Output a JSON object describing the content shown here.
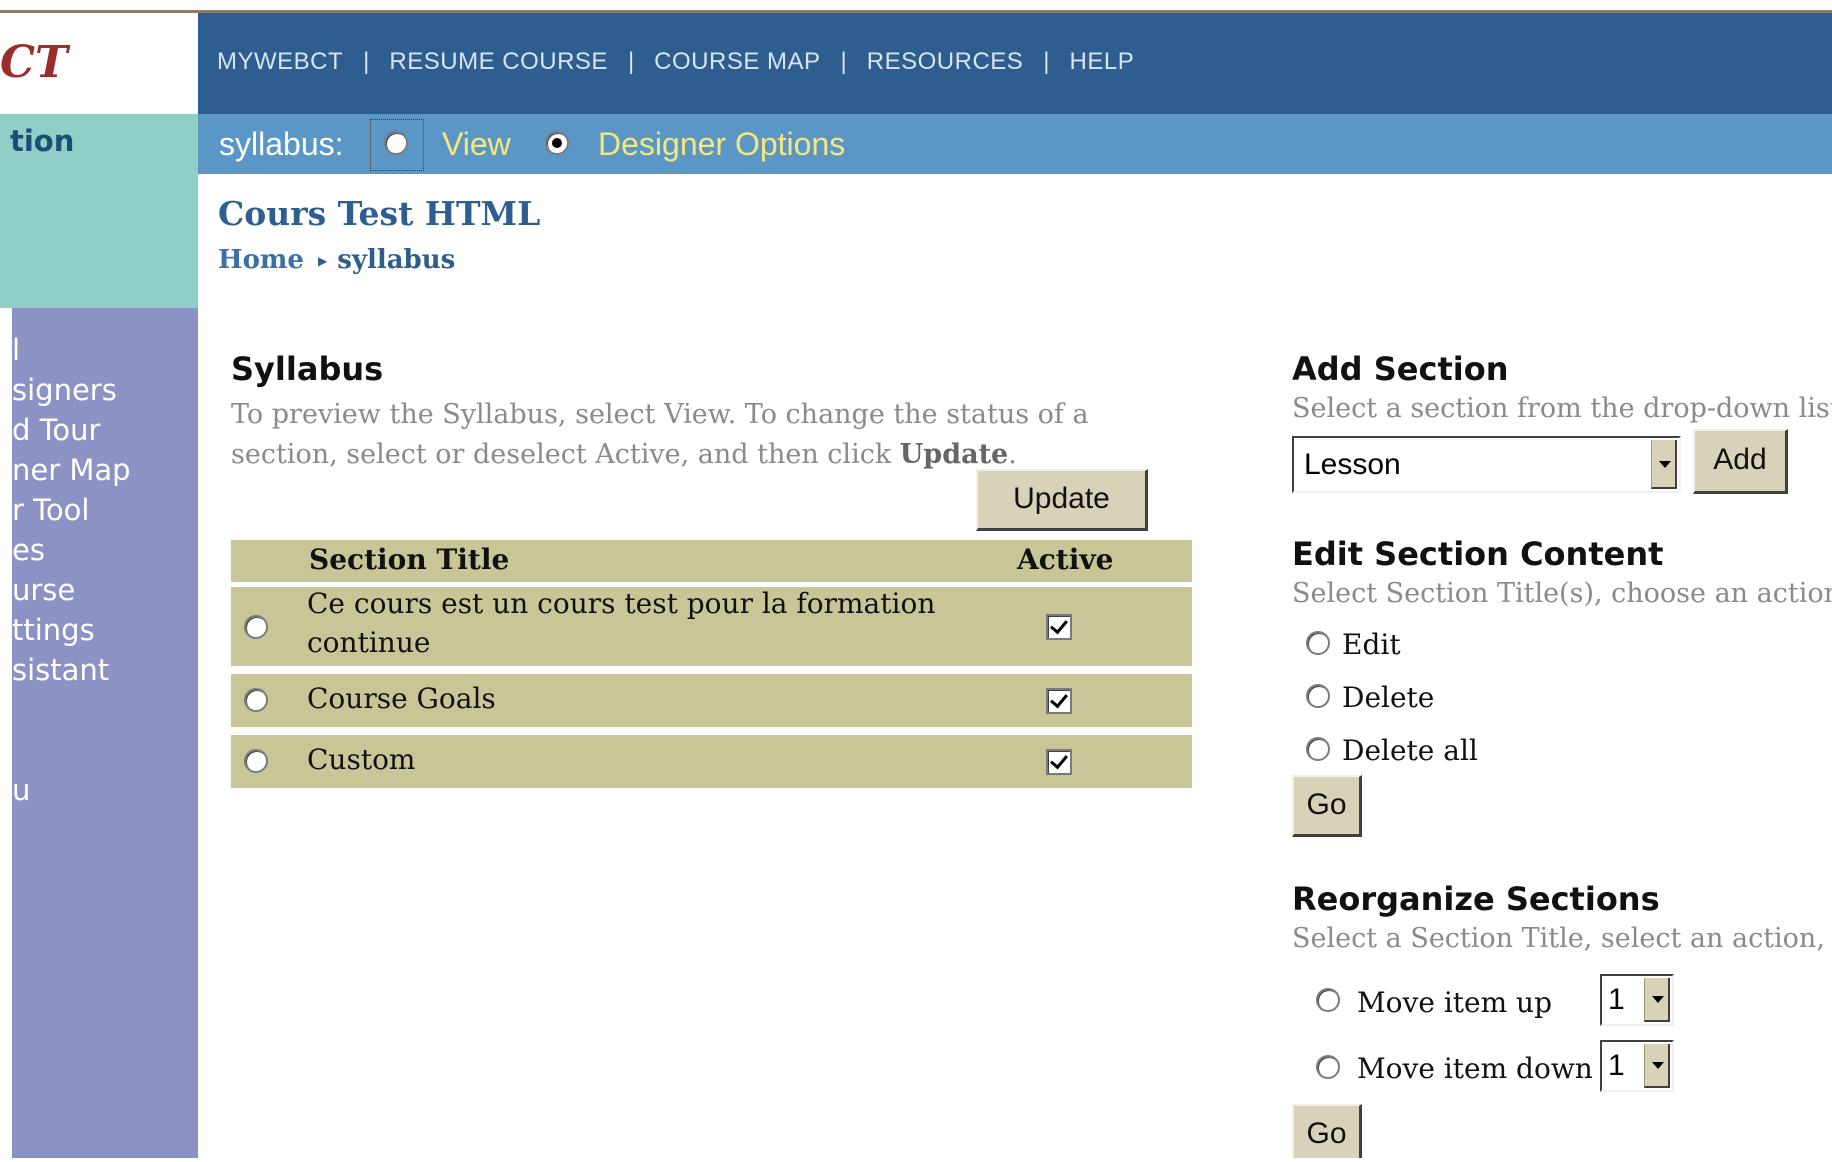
{
  "sidebar": {
    "logo_fragment": "CT",
    "section_fragment": "tion",
    "items": [
      "l",
      "signers",
      "d Tour",
      "ner Map",
      "r Tool",
      "es",
      "urse",
      "ttings",
      "sistant",
      "u"
    ]
  },
  "topnav": {
    "items": [
      "MYWEBCT",
      "RESUME COURSE",
      "COURSE MAP",
      "RESOURCES",
      "HELP"
    ],
    "separator": "|"
  },
  "mode_bar": {
    "label": "syllabus:",
    "options": [
      {
        "label": "View",
        "selected": false
      },
      {
        "label": "Designer Options",
        "selected": true
      }
    ]
  },
  "page": {
    "title": "Cours Test HTML",
    "breadcrumb": {
      "home": "Home",
      "current": "syllabus"
    }
  },
  "syllabus": {
    "heading": "Syllabus",
    "description_pre": "To preview the Syllabus, select View. To change the status of a section, select or deselect Active, and then click ",
    "description_bold": "Update",
    "description_post": ".",
    "update_button": "Update",
    "columns": {
      "title": "Section Title",
      "active": "Active"
    },
    "rows": [
      {
        "title_line1": "Ce cours est un cours test pour la formation",
        "title_line2": "continue",
        "active": true
      },
      {
        "title_line1": "Course Goals",
        "title_line2": "",
        "active": true
      },
      {
        "title_line1": "Custom",
        "title_line2": "",
        "active": true
      }
    ]
  },
  "add_section": {
    "heading": "Add Section",
    "description": "Select a section from the drop-down list",
    "selected": "Lesson",
    "button": "Add"
  },
  "edit_section": {
    "heading": "Edit Section Content",
    "description": "Select Section Title(s), choose an action",
    "options": [
      "Edit",
      "Delete",
      "Delete all"
    ],
    "button": "Go"
  },
  "reorganize": {
    "heading": "Reorganize Sections",
    "description": "Select a Section Title, select an action, a",
    "options": [
      {
        "label": "Move item up",
        "value": "1"
      },
      {
        "label": "Move item down",
        "value": "1"
      }
    ],
    "button": "Go"
  }
}
